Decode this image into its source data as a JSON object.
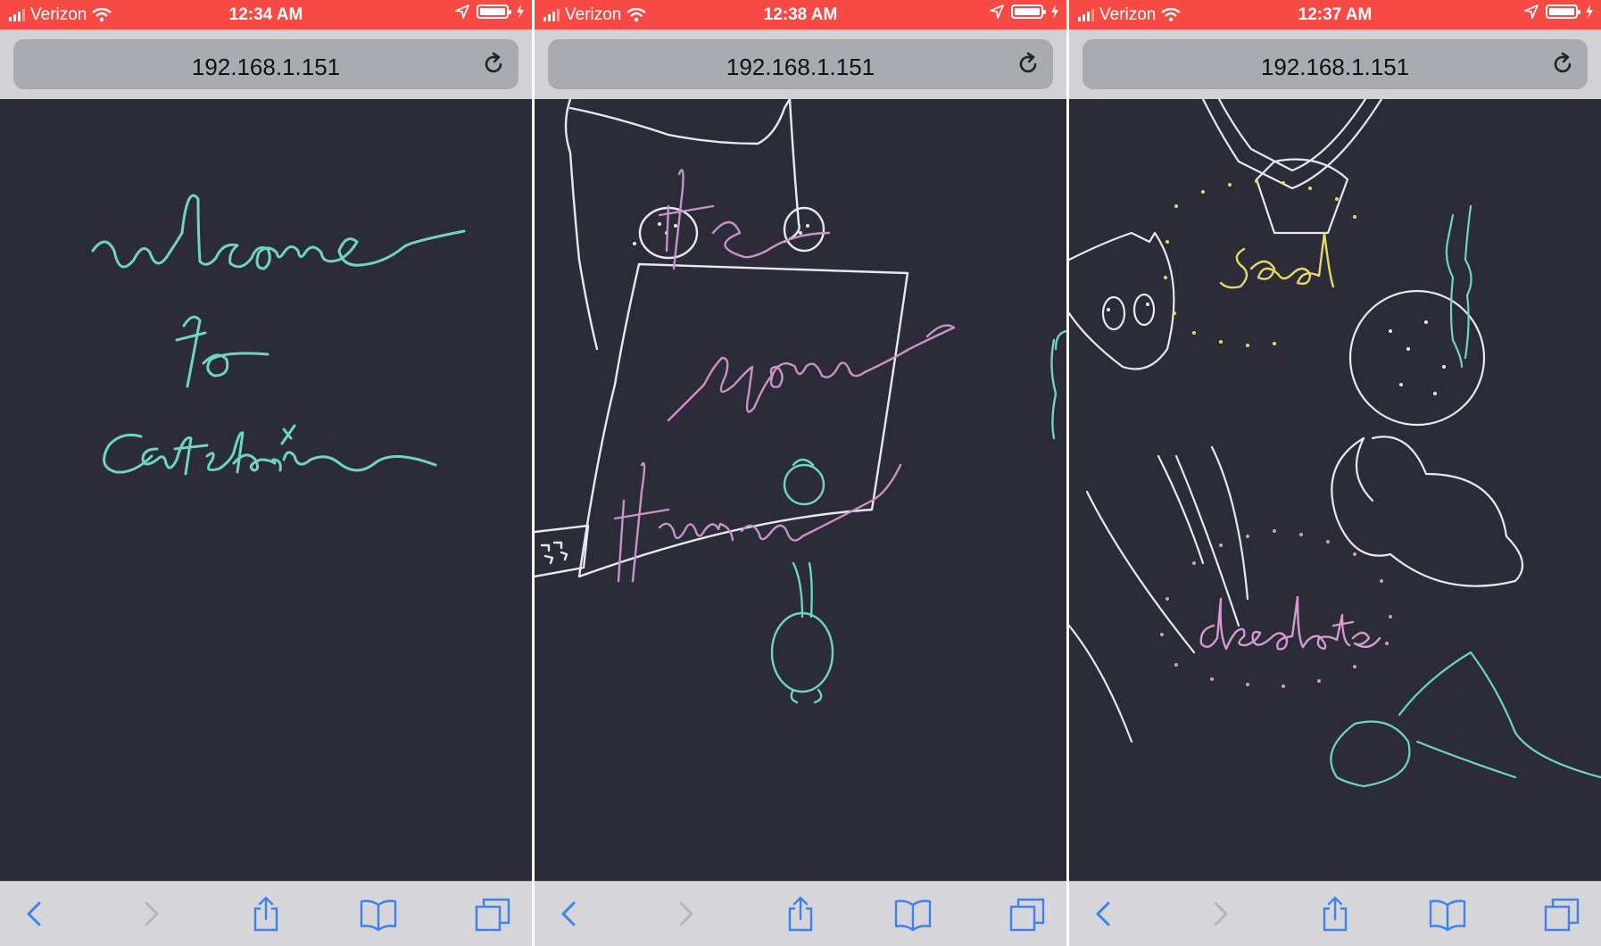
{
  "screens": [
    {
      "status": {
        "carrier": "Verizon",
        "time": "12:34 AM"
      },
      "url": "192.168.1.151",
      "drawing_words": [
        "welcome",
        "to",
        "catslair"
      ],
      "colors": {
        "ink": "#6fd6bd"
      }
    },
    {
      "status": {
        "carrier": "Verizon",
        "time": "12:38 AM"
      },
      "url": "192.168.1.151",
      "drawing_words": [
        "its",
        "your",
        "turn"
      ],
      "colors": {
        "ink": "#c993c9",
        "sketch": "#e8e8ee",
        "figure": "#6fd6bd"
      }
    },
    {
      "status": {
        "carrier": "Verizon",
        "time": "12:37 AM"
      },
      "url": "192.168.1.151",
      "drawing_words": [
        "sad",
        "desolate"
      ],
      "colors": {
        "sad": "#e8d96a",
        "desolate": "#d59ad0",
        "sketch": "#e8e8ee",
        "figure": "#6fd6bd"
      }
    }
  ],
  "theme": {
    "status_bar": "#f74a44",
    "canvas": "#2b2c37",
    "toolbar": "#d6d6da",
    "accent": "#3d82f0"
  },
  "icons": [
    "signal-icon",
    "wifi-icon",
    "location-icon",
    "battery-icon",
    "charging-icon",
    "reload-icon",
    "back-icon",
    "forward-icon",
    "share-icon",
    "bookmarks-icon",
    "tabs-icon"
  ]
}
